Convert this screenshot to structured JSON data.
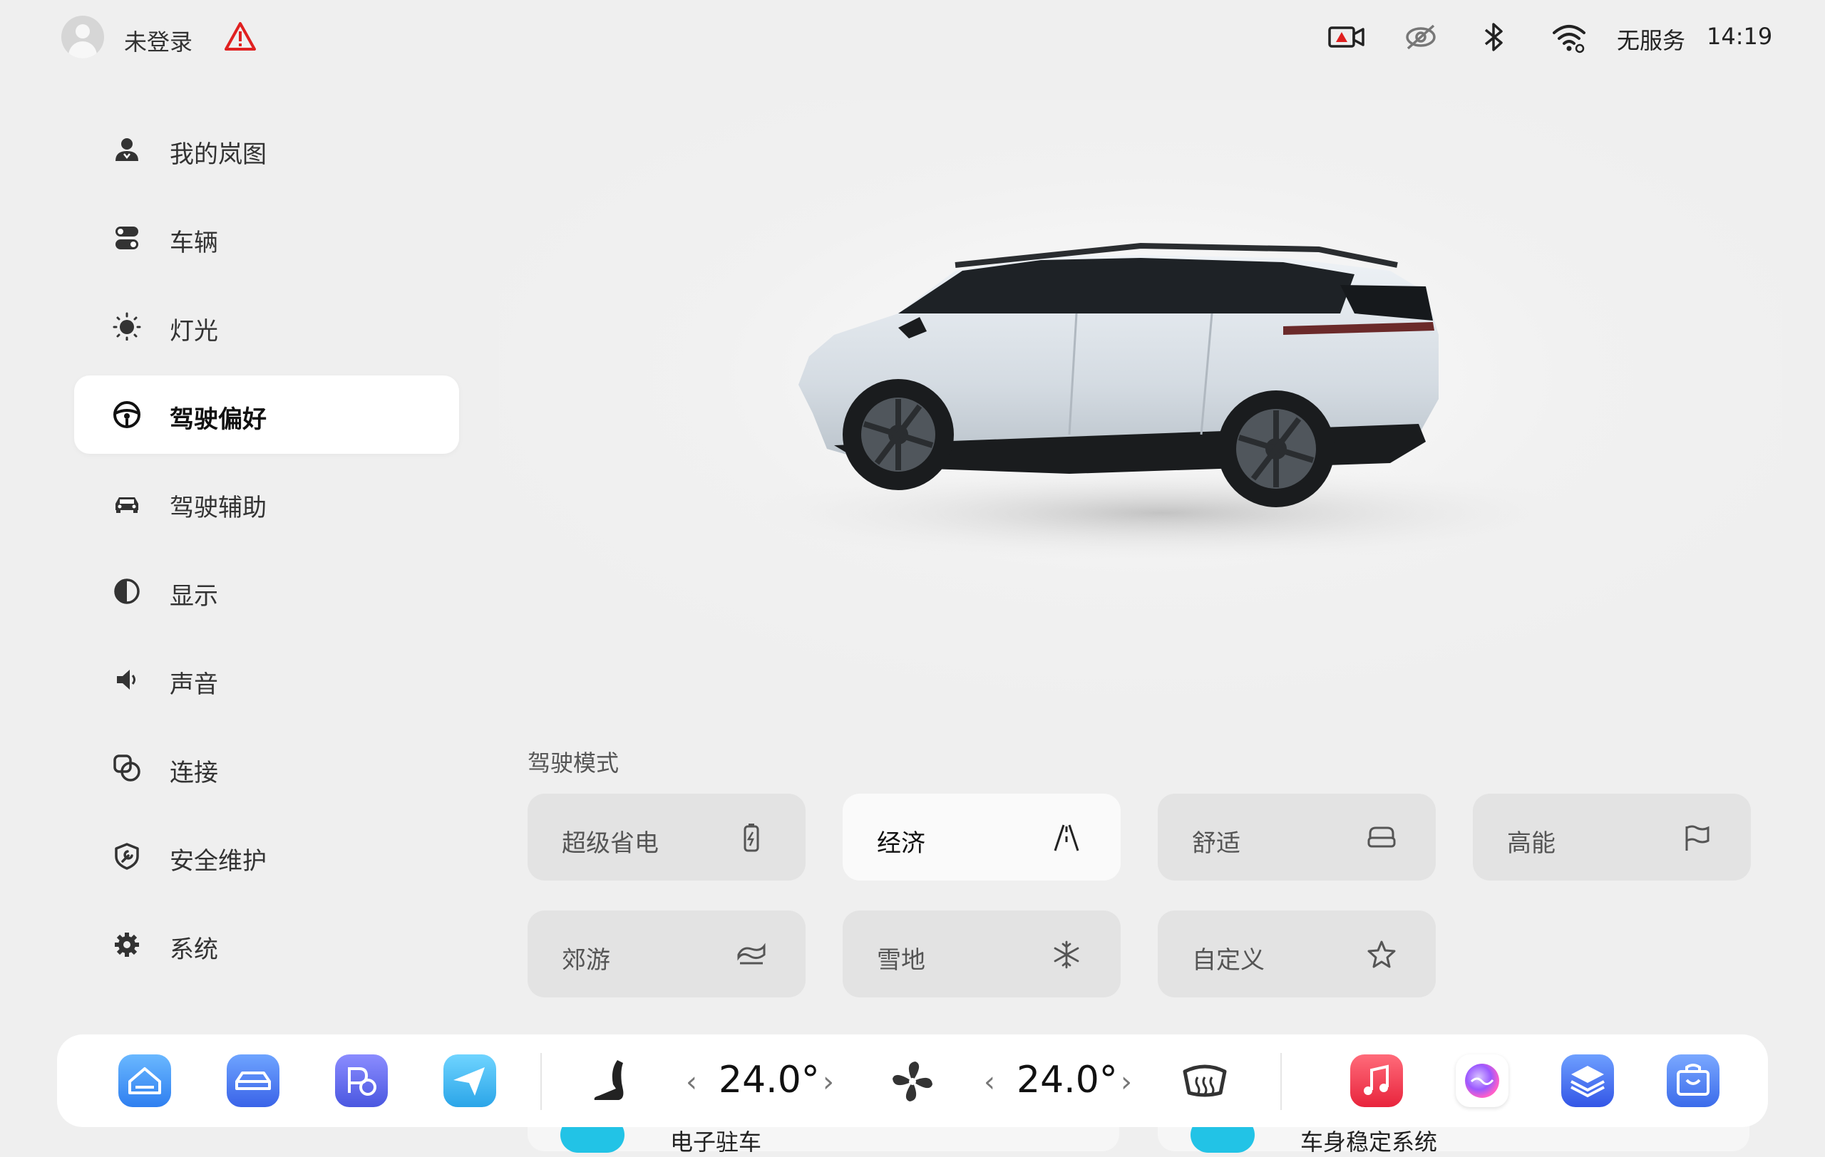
{
  "status": {
    "login_text": "未登录",
    "service_text": "无服务",
    "time": "14:19"
  },
  "sidebar": {
    "items": [
      {
        "label": "我的岚图",
        "icon": "user-icon"
      },
      {
        "label": "车辆",
        "icon": "vehicle-toggle-icon"
      },
      {
        "label": "灯光",
        "icon": "light-icon"
      },
      {
        "label": "驾驶偏好",
        "icon": "steering-wheel-icon",
        "active": true
      },
      {
        "label": "驾驶辅助",
        "icon": "car-front-icon"
      },
      {
        "label": "显示",
        "icon": "contrast-icon"
      },
      {
        "label": "声音",
        "icon": "speaker-icon"
      },
      {
        "label": "连接",
        "icon": "link-icon"
      },
      {
        "label": "安全维护",
        "icon": "shield-wrench-icon"
      },
      {
        "label": "系统",
        "icon": "gear-icon"
      }
    ]
  },
  "drive_modes": {
    "title": "驾驶模式",
    "selected": "经济",
    "modes": [
      {
        "label": "超级省电",
        "icon": "battery-icon"
      },
      {
        "label": "经济",
        "icon": "road-icon"
      },
      {
        "label": "舒适",
        "icon": "sofa-icon"
      },
      {
        "label": "高能",
        "icon": "flag-icon"
      },
      {
        "label": "郊游",
        "icon": "terrain-icon"
      },
      {
        "label": "雪地",
        "icon": "snowflake-icon"
      },
      {
        "label": "自定义",
        "icon": "star-icon"
      }
    ]
  },
  "peek": {
    "left": "电子驻车",
    "right": "车身稳定系统"
  },
  "dock": {
    "temp_left": "24.0°",
    "temp_right": "24.0°",
    "chev_left": "‹",
    "chev_right": "›",
    "apps_left": [
      "home-app-icon",
      "car-app-icon",
      "parking-app-icon",
      "navigation-app-icon"
    ],
    "apps_right": [
      "music-app-icon",
      "assistant-app-icon",
      "layers-app-icon",
      "store-app-icon"
    ]
  }
}
